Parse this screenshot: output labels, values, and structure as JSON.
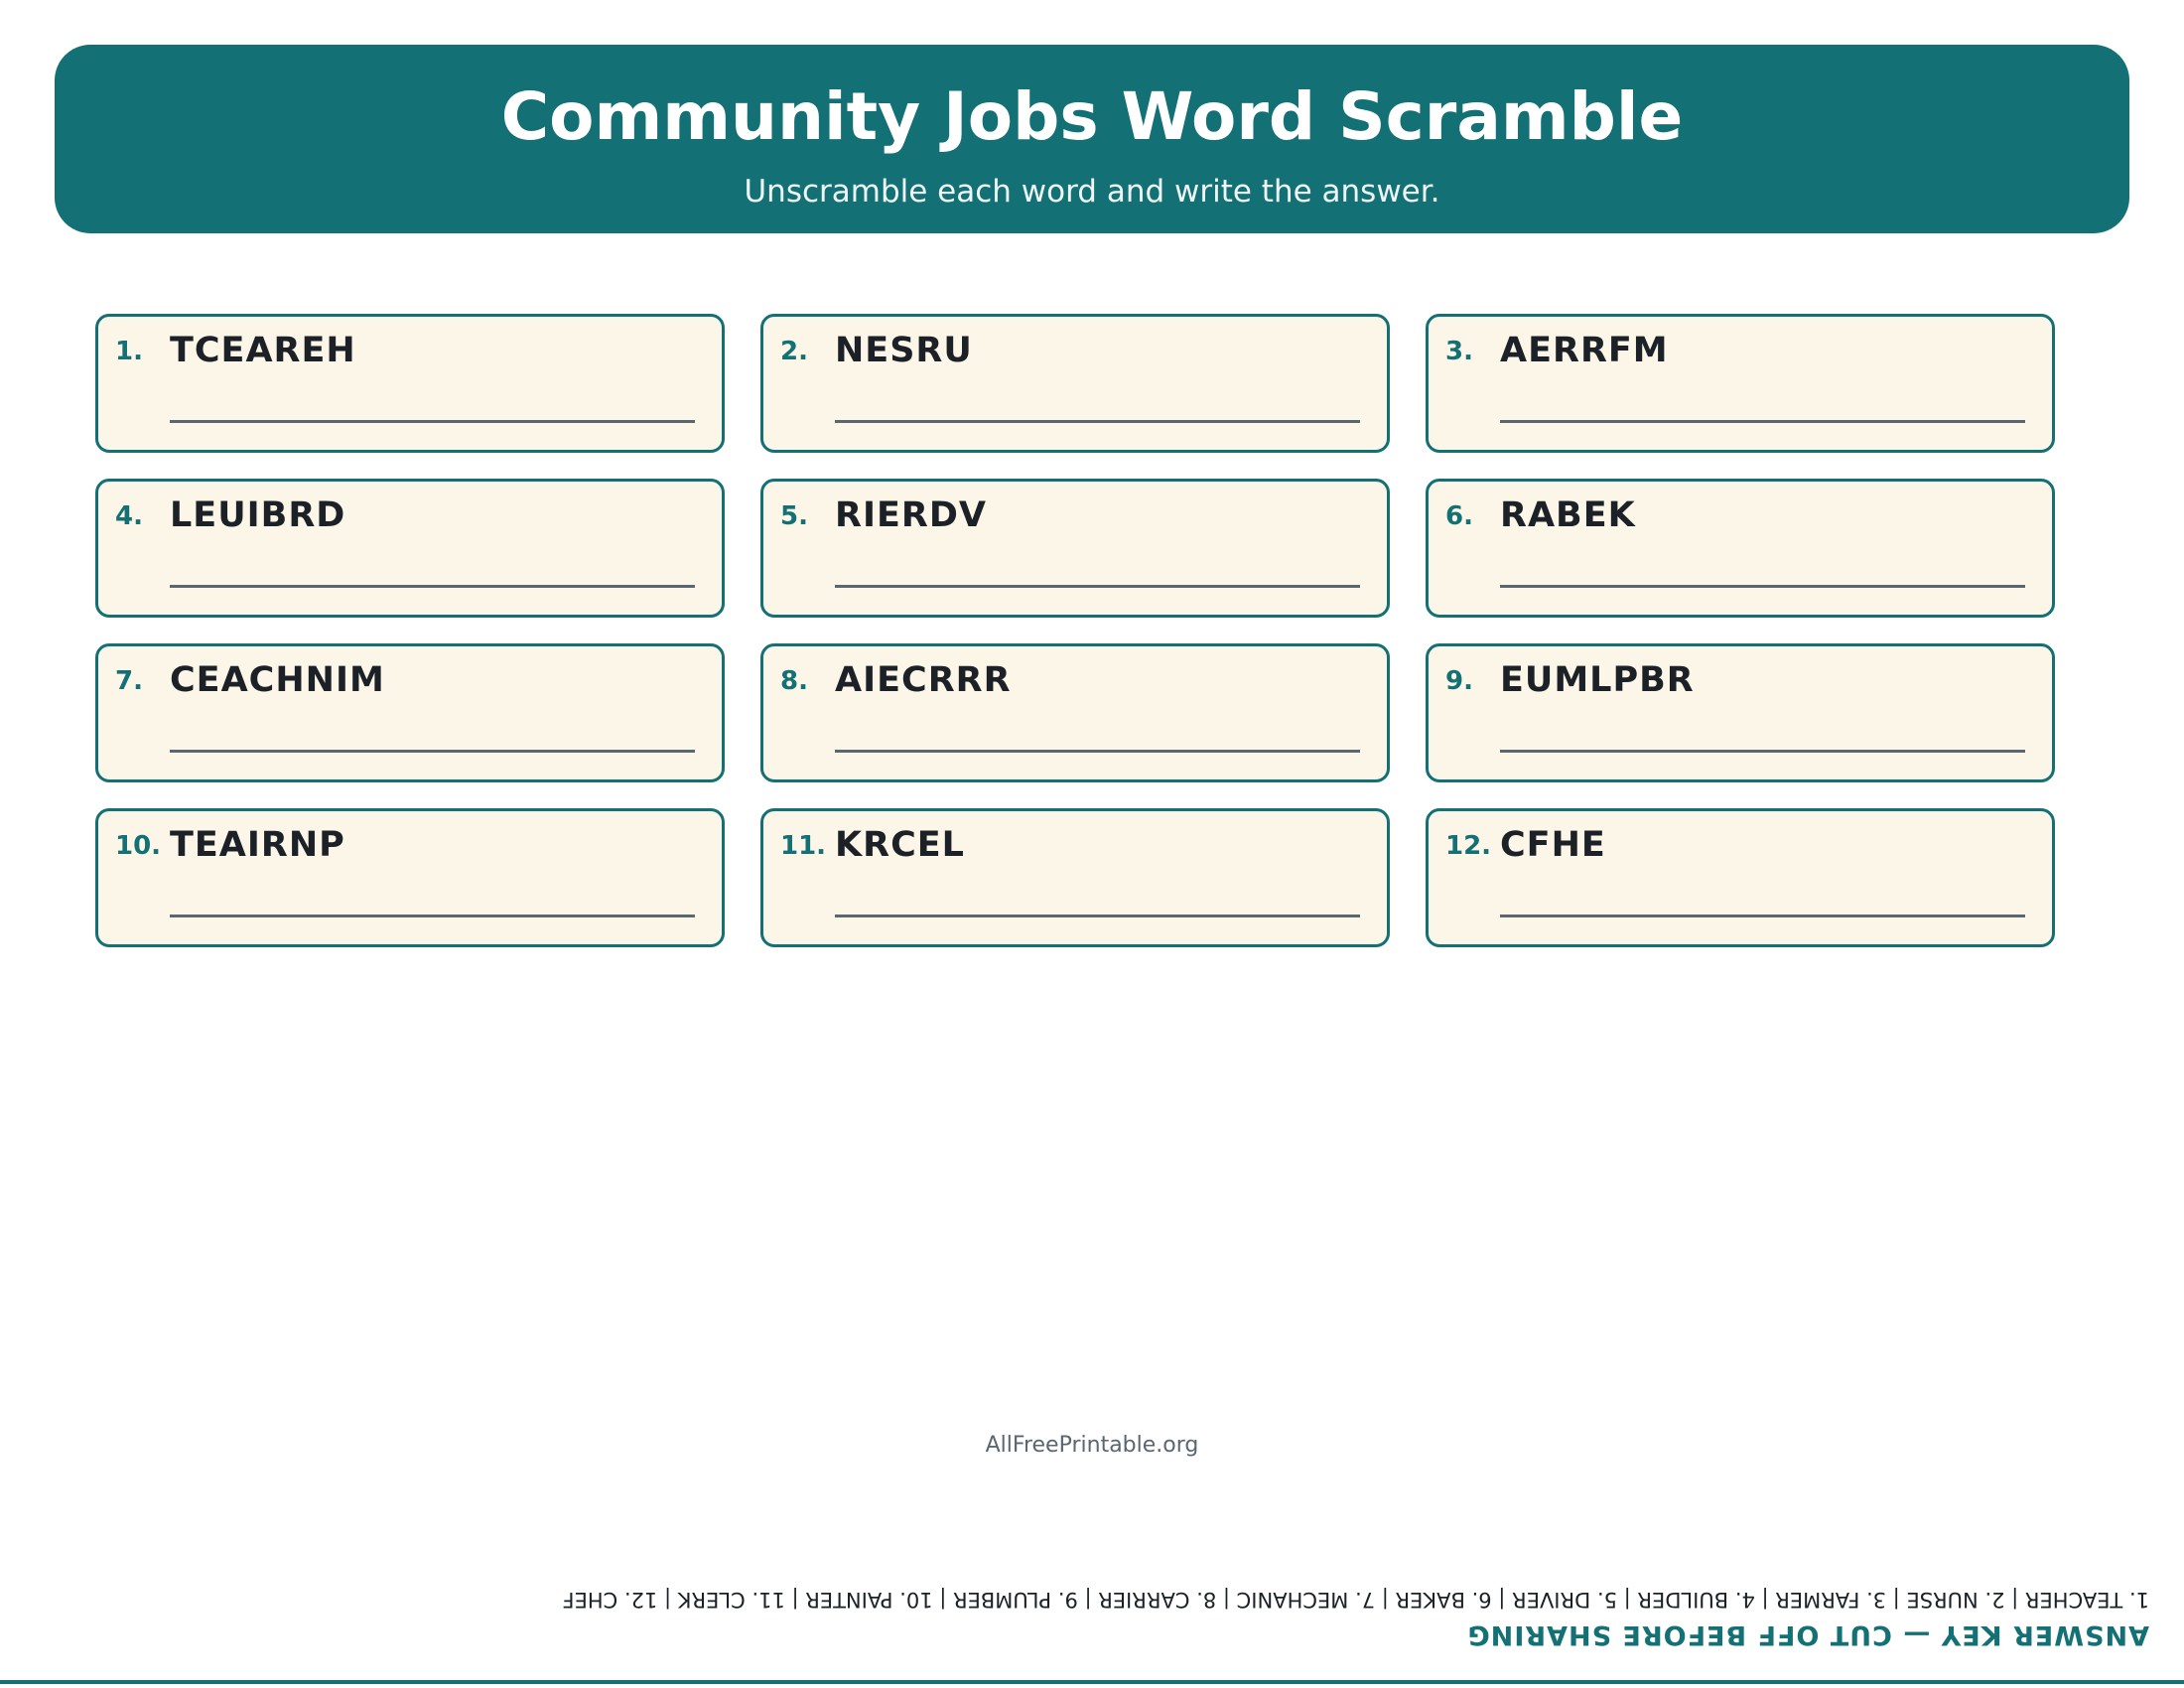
{
  "header": {
    "title": "Community Jobs Word Scramble",
    "subtitle": "Unscramble each word and write the answer."
  },
  "items": [
    {
      "num": "1.",
      "word": "TCEAREH"
    },
    {
      "num": "2.",
      "word": "NESRU"
    },
    {
      "num": "3.",
      "word": "AERRFM"
    },
    {
      "num": "4.",
      "word": "LEUIBRD"
    },
    {
      "num": "5.",
      "word": "RIERDV"
    },
    {
      "num": "6.",
      "word": "RABEK"
    },
    {
      "num": "7.",
      "word": "CEACHNIM"
    },
    {
      "num": "8.",
      "word": "AIECRRR"
    },
    {
      "num": "9.",
      "word": "EUMLPBR"
    },
    {
      "num": "10.",
      "word": "TEAIRNP"
    },
    {
      "num": "11.",
      "word": "KRCEL"
    },
    {
      "num": "12.",
      "word": "CFHE"
    }
  ],
  "footer": {
    "site": "AllFreePrintable.org"
  },
  "answer_key": {
    "title": "ANSWER KEY — CUT OFF BEFORE SHARING",
    "answers": "1. TEACHER | 2. NURSE | 3. FARMER | 4. BUILDER | 5. DRIVER | 6. BAKER | 7. MECHANIC | 8. CARRIER | 9. PLUMBER | 10. PAINTER | 11. CLERK | 12. CHEF"
  },
  "colors": {
    "accent": "#137075",
    "card_background": "#fcf6e8",
    "text": "#1b2126"
  }
}
